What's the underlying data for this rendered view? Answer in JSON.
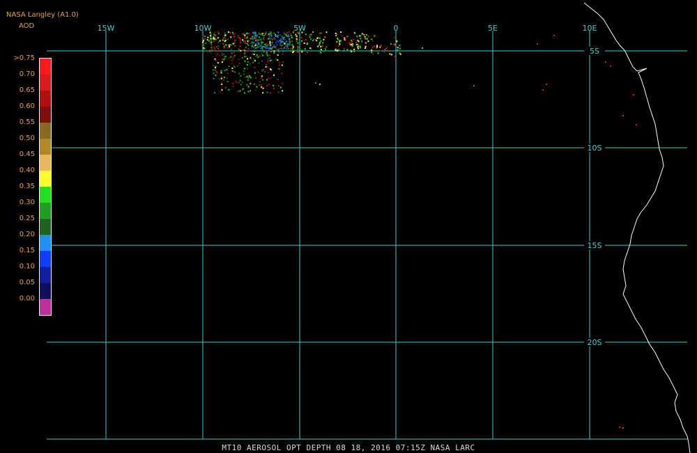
{
  "header": {
    "title": "NASA Langley (A1.0)",
    "product": "AOD"
  },
  "footer": {
    "caption": "MT10  AEROSOL OPT DEPTH   08 18, 2016 07:15Z   NASA LARC"
  },
  "grid": {
    "color": "#40d0d0",
    "lon_labels": [
      "15W",
      "10W",
      "5W",
      "0",
      "5E",
      "10E"
    ],
    "lat_labels": [
      "5S",
      "10S",
      "15S",
      "20S"
    ]
  },
  "legend": {
    "labels": [
      ">0.75",
      "0.70",
      "0.65",
      "0.60",
      "0.55",
      "0.50",
      "0.45",
      "0.40",
      "0.35",
      "0.30",
      "0.25",
      "0.20",
      "0.15",
      "0.10",
      "0.05",
      "0.00"
    ],
    "colors": [
      "#ff1a1a",
      "#d81c1c",
      "#b01010",
      "#801010",
      "#8a6a20",
      "#b08828",
      "#e8b860",
      "#ffff30",
      "#20e020",
      "#20a020",
      "#206020",
      "#2090ff",
      "#1040ff",
      "#1020a0",
      "#101060",
      "#c0309a"
    ]
  },
  "coastline_color": "#ffffff"
}
